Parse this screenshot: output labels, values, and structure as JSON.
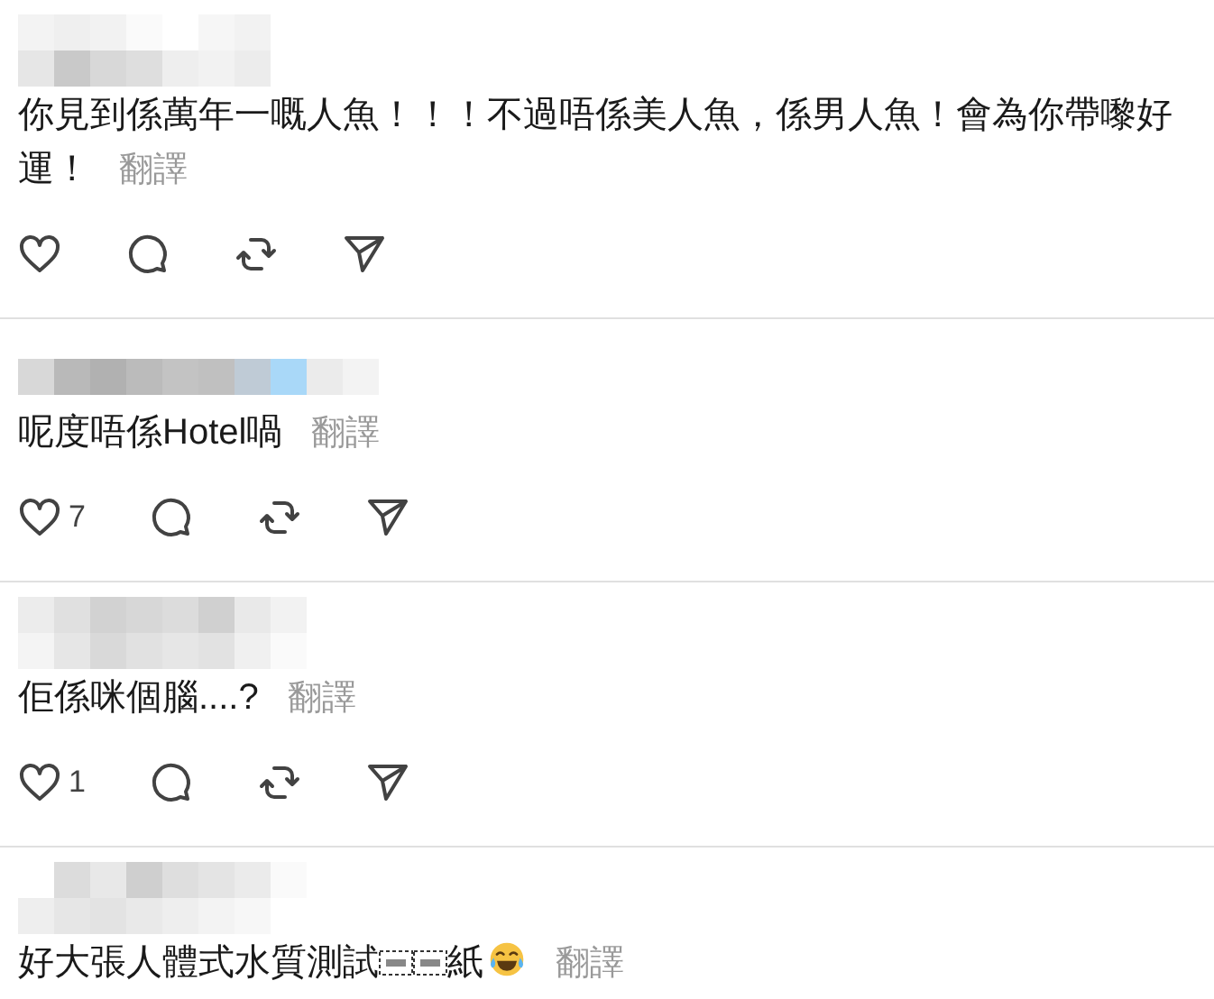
{
  "comments": [
    {
      "parts": [
        {
          "kind": "text",
          "value": "你見到係萬年一嘅人魚！！！不過唔係美人魚，係男人魚！會為你帶嚟好運！"
        }
      ],
      "translate": "翻譯"
    },
    {
      "parts": [
        {
          "kind": "text",
          "value": "呢度唔係Hotel喎"
        }
      ],
      "translate": "翻譯",
      "likes": "7"
    },
    {
      "parts": [
        {
          "kind": "text",
          "value": "佢係咪個腦....?"
        }
      ],
      "translate": "翻譯",
      "likes": "1"
    },
    {
      "parts": [
        {
          "kind": "text",
          "value": "好大張人體式水質測試"
        },
        {
          "kind": "object_glyph"
        },
        {
          "kind": "object_glyph"
        },
        {
          "kind": "text",
          "value": "紙"
        },
        {
          "kind": "emoji"
        }
      ],
      "translate": "翻譯"
    }
  ]
}
